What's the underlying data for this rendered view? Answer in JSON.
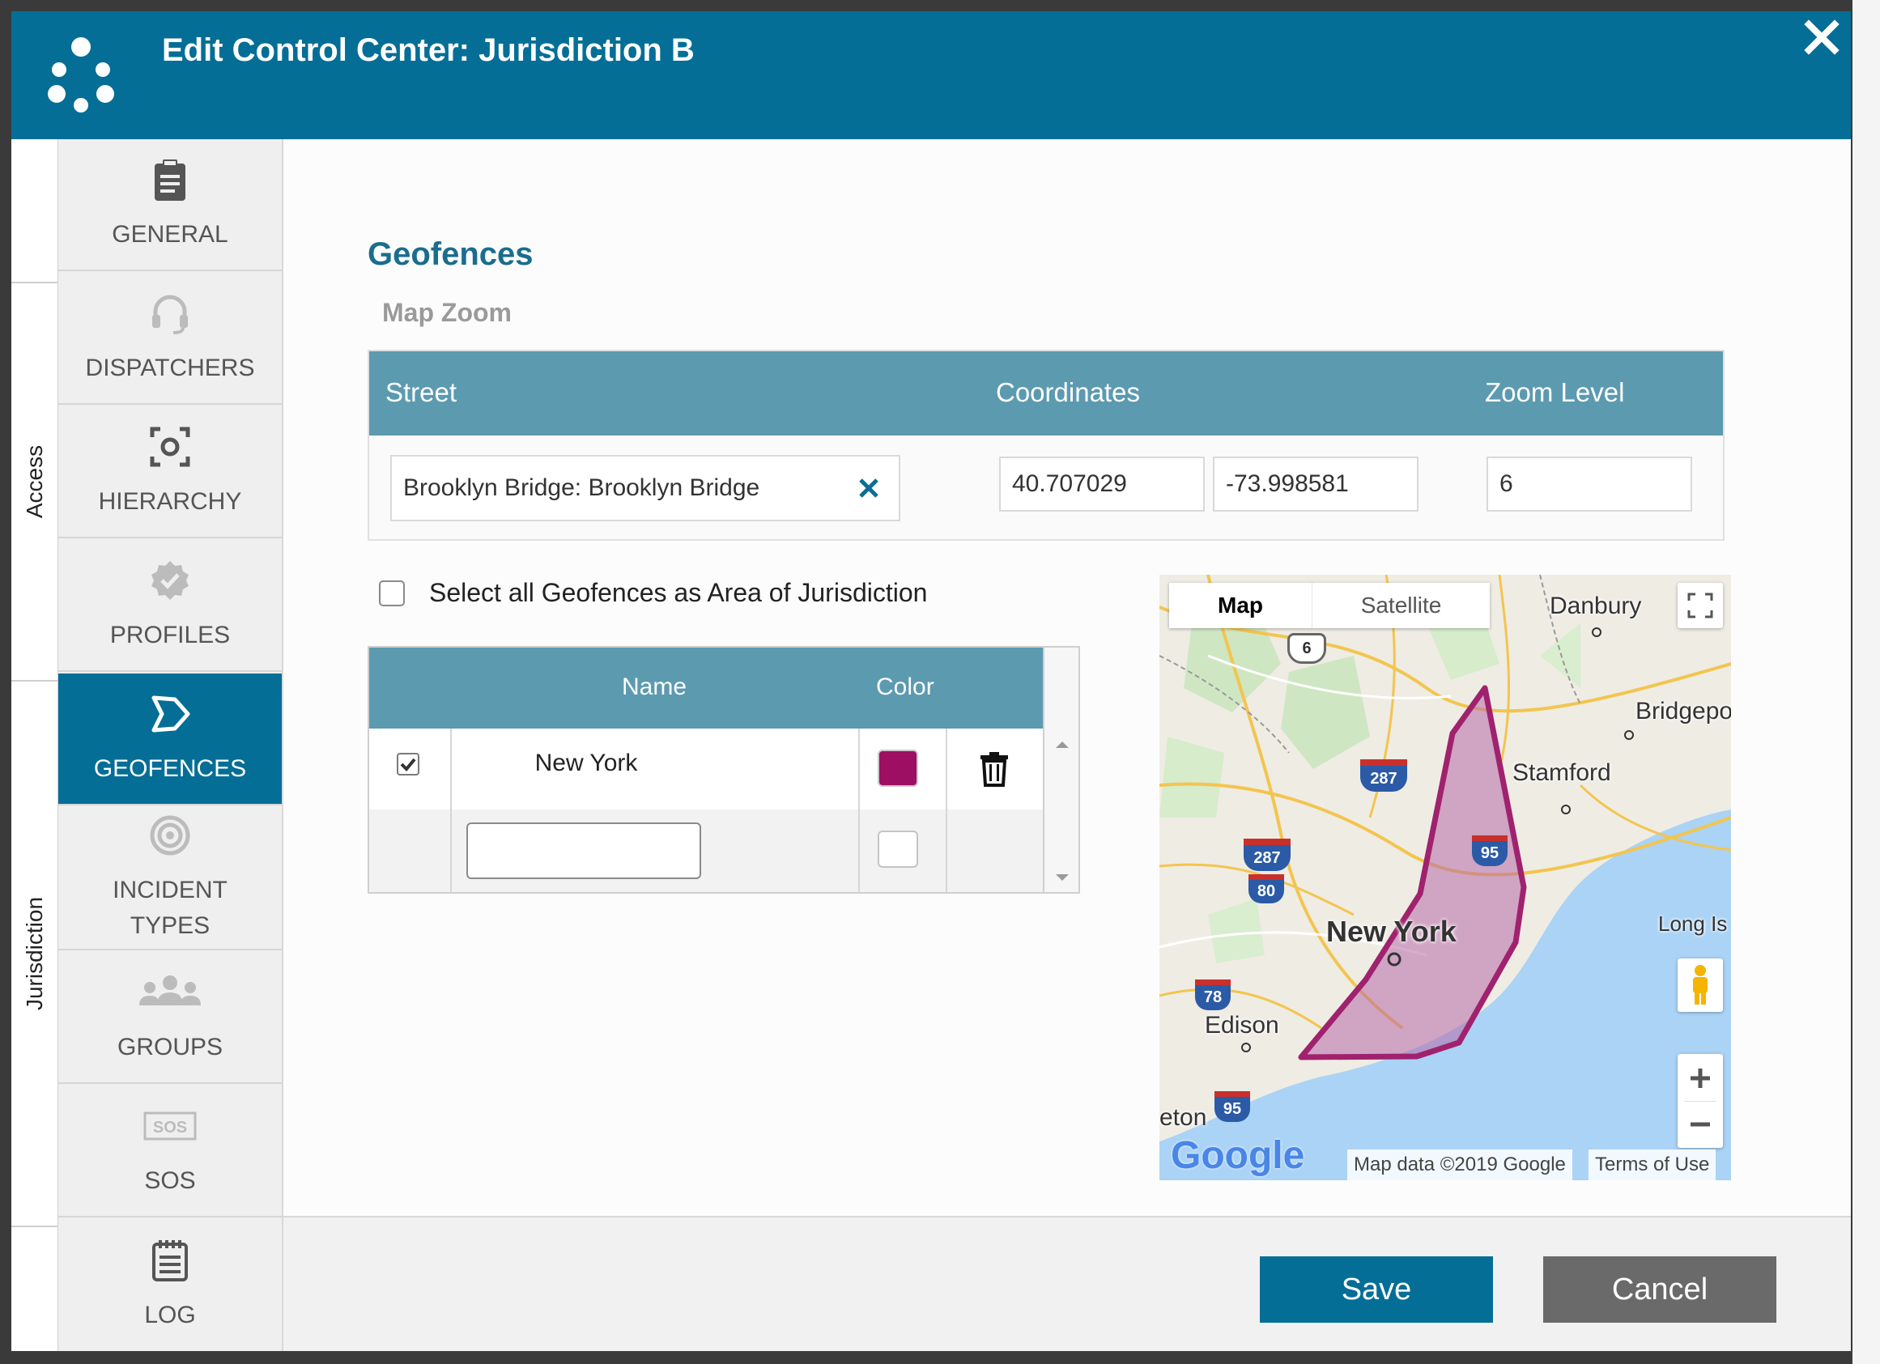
{
  "dialog": {
    "title": "Edit Control Center: Jurisdiction B"
  },
  "vertical_tabs": [
    "Access",
    "Jurisdiction"
  ],
  "sidenav": [
    {
      "label": "GENERAL",
      "icon": "clipboard-icon"
    },
    {
      "label": "DISPATCHERS",
      "icon": "headset-icon"
    },
    {
      "label": "HIERARCHY",
      "icon": "hierarchy-icon"
    },
    {
      "label": "PROFILES",
      "icon": "badge-icon"
    },
    {
      "label": "GEOFENCES",
      "icon": "geofence-icon",
      "active": true
    },
    {
      "label": "INCIDENT TYPES",
      "icon": "target-icon"
    },
    {
      "label": "GROUPS",
      "icon": "groups-icon"
    },
    {
      "label": "SOS",
      "icon": "sos-icon"
    },
    {
      "label": "LOG",
      "icon": "log-icon"
    }
  ],
  "geofences": {
    "title": "Geofences",
    "map_zoom": {
      "label": "Map Zoom",
      "headers": {
        "street": "Street",
        "coordinates": "Coordinates",
        "zoom": "Zoom Level"
      },
      "street_value": "Brooklyn Bridge: Brooklyn Bridge",
      "latitude": "40.707029",
      "longitude": "-73.998581",
      "zoom_level": "6"
    },
    "select_all_label": "Select all Geofences as Area of Jurisdiction",
    "select_all_checked": false,
    "table": {
      "headers": {
        "name": "Name",
        "color": "Color"
      },
      "rows": [
        {
          "checked": true,
          "name": "New York",
          "color": "#9c0f63"
        }
      ],
      "new_row": {
        "name": "",
        "color": "#ffffff"
      }
    }
  },
  "map": {
    "type_map": "Map",
    "type_satellite": "Satellite",
    "places": [
      "Danbury",
      "Bridgeport",
      "Stamford",
      "New York",
      "Long Is",
      "Edison",
      "eton"
    ],
    "highways": [
      "6",
      "287",
      "287",
      "80",
      "95",
      "78",
      "95"
    ],
    "logo": "Google",
    "attribution": "Map data ©2019 Google",
    "terms": "Terms of Use",
    "geofence_color": "#a0226e"
  },
  "footer": {
    "save": "Save",
    "cancel": "Cancel"
  },
  "colors": {
    "header": "#046e96",
    "table_header": "#5c9ab0",
    "cancel": "#6a6a6a"
  }
}
